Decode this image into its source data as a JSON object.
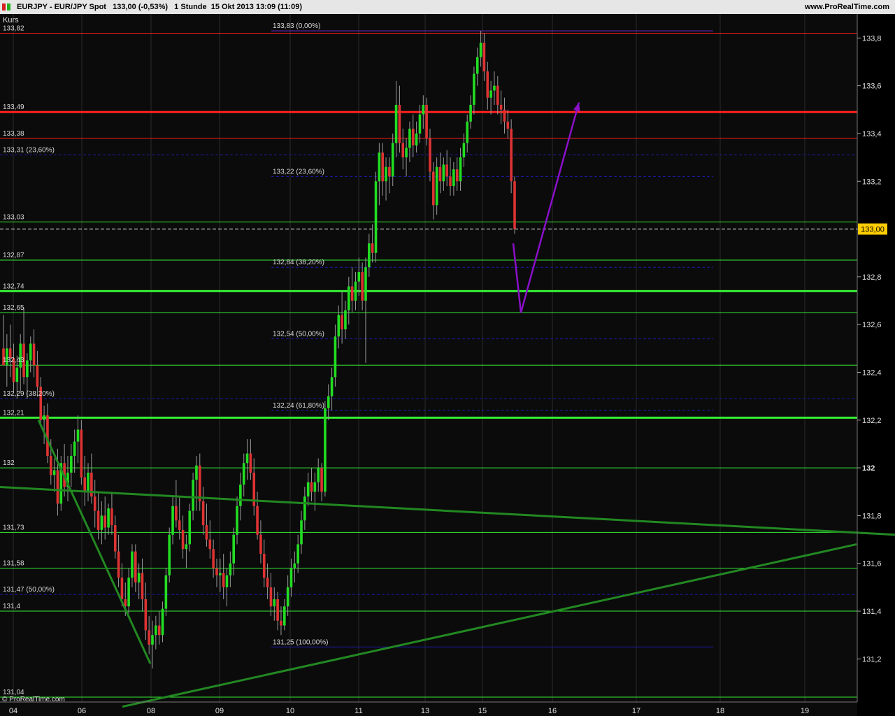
{
  "header": {
    "title": "EURJPY - EUR/JPY Spot   133,00 (-0,53%)   1 Stunde  15 Okt 2013 13:09 (11:09)",
    "website": "www.ProRealTime.com"
  },
  "panel_label": "Kurs",
  "watermark": "© ProRealTime.com",
  "colors": {
    "background": "#0b0b0b",
    "up_candle": "#22dd22",
    "down_candle": "#dd3333",
    "resistance": "#ff2020",
    "support": "#35ee35",
    "fibonacci": "#1a1aa8",
    "trend": "#228822",
    "projection": "#8a10c8",
    "price_tag": "#ffcc00"
  },
  "chart_data": {
    "type": "candlestick",
    "symbol": "EURJPY",
    "interval": "1 Stunde",
    "ylim": [
      131.04,
      133.88
    ],
    "y_ticks": [
      "133,8",
      "133,6",
      "133,4",
      "133,2",
      "133",
      "132,8",
      "132,6",
      "132,4",
      "132,2",
      "132",
      "131,8",
      "131,6",
      "131,4",
      "131,2"
    ],
    "y_tick_values": [
      133.8,
      133.6,
      133.4,
      133.2,
      133.0,
      132.8,
      132.6,
      132.4,
      132.2,
      132.0,
      131.8,
      131.6,
      131.4,
      131.2
    ],
    "x_ticks": [
      "04",
      "06",
      "08",
      "09",
      "10",
      "11",
      "13",
      "15",
      "16",
      "17",
      "18",
      "19"
    ],
    "last_price": "133,00",
    "last_price_value": 133.0,
    "resistance_lines": [
      {
        "label": "133,82",
        "value": 133.82,
        "style": "thin"
      },
      {
        "label": "133,49",
        "value": 133.49,
        "style": "thick"
      },
      {
        "label": "133,38",
        "value": 133.38,
        "style": "thin"
      }
    ],
    "support_lines": [
      {
        "label": "133,03",
        "value": 133.03,
        "style": "thin"
      },
      {
        "label": "132,87",
        "value": 132.87,
        "style": "thin"
      },
      {
        "label": "132,74",
        "value": 132.74,
        "style": "thick"
      },
      {
        "label": "132,65",
        "value": 132.65,
        "style": "thin"
      },
      {
        "label": "132,43",
        "value": 132.43,
        "style": "thin"
      },
      {
        "label": "132,21",
        "value": 132.21,
        "style": "thick"
      },
      {
        "label": "132",
        "value": 132.0,
        "style": "thin"
      },
      {
        "label": "131,73",
        "value": 131.73,
        "style": "thin"
      },
      {
        "label": "131,58",
        "value": 131.58,
        "style": "thin"
      },
      {
        "label": "131,4",
        "value": 131.4,
        "style": "thin"
      },
      {
        "label": "131,04",
        "value": 131.04,
        "style": "thin"
      }
    ],
    "fib_left": [
      {
        "label": "133,31 (23,60%)",
        "value": 133.31
      },
      {
        "label": "132,29 (38,20%)",
        "value": 132.29
      },
      {
        "label": "131,47 (50,00%)",
        "value": 131.47
      }
    ],
    "fib_middle": [
      {
        "label": "133,83 (0,00%)",
        "value": 133.83
      },
      {
        "label": "133,22 (23,60%)",
        "value": 133.22
      },
      {
        "label": "132,84 (38,20%)",
        "value": 132.84
      },
      {
        "label": "132,54 (50,00%)",
        "value": 132.54
      },
      {
        "label": "132,24 (61,80%)",
        "value": 132.24
      },
      {
        "label": "131,25 (100,00%)",
        "value": 131.25
      }
    ],
    "trend_lines": [
      {
        "from": [
          0,
          131.92
        ],
        "to": [
          1280,
          131.72
        ]
      },
      {
        "from": [
          175,
          131.0
        ],
        "to": [
          1225,
          131.68
        ]
      },
      {
        "from": [
          55,
          132.2
        ],
        "to": [
          215,
          131.18
        ]
      }
    ],
    "projection": [
      [
        734,
        132.94
      ],
      [
        745,
        132.65
      ],
      [
        828,
        133.53
      ]
    ],
    "candles": [
      {
        "o": 132.5,
        "h": 132.64,
        "l": 132.43,
        "c": 132.43
      },
      {
        "o": 132.43,
        "h": 132.56,
        "l": 132.34,
        "c": 132.5
      },
      {
        "o": 132.5,
        "h": 132.6,
        "l": 132.38,
        "c": 132.46
      },
      {
        "o": 132.46,
        "h": 132.52,
        "l": 132.32,
        "c": 132.36
      },
      {
        "o": 132.36,
        "h": 132.47,
        "l": 132.29,
        "c": 132.42
      },
      {
        "o": 132.42,
        "h": 132.56,
        "l": 132.32,
        "c": 132.52
      },
      {
        "o": 132.52,
        "h": 132.67,
        "l": 132.35,
        "c": 132.38
      },
      {
        "o": 132.38,
        "h": 132.48,
        "l": 132.29,
        "c": 132.45
      },
      {
        "o": 132.45,
        "h": 132.55,
        "l": 132.4,
        "c": 132.52
      },
      {
        "o": 132.52,
        "h": 132.58,
        "l": 132.38,
        "c": 132.43
      },
      {
        "o": 132.43,
        "h": 132.49,
        "l": 132.3,
        "c": 132.34
      },
      {
        "o": 132.34,
        "h": 132.38,
        "l": 132.17,
        "c": 132.2
      },
      {
        "o": 132.2,
        "h": 132.26,
        "l": 132.1,
        "c": 132.22
      },
      {
        "o": 132.22,
        "h": 132.27,
        "l": 132.02,
        "c": 132.05
      },
      {
        "o": 132.05,
        "h": 132.12,
        "l": 131.93,
        "c": 131.97
      },
      {
        "o": 131.97,
        "h": 132.04,
        "l": 131.9,
        "c": 131.99
      },
      {
        "o": 131.99,
        "h": 132.08,
        "l": 131.8,
        "c": 131.85
      },
      {
        "o": 131.85,
        "h": 132.05,
        "l": 131.82,
        "c": 132.02
      },
      {
        "o": 132.02,
        "h": 132.1,
        "l": 131.88,
        "c": 131.92
      },
      {
        "o": 131.92,
        "h": 132.05,
        "l": 131.86,
        "c": 131.98
      },
      {
        "o": 131.98,
        "h": 132.1,
        "l": 131.92,
        "c": 132.05
      },
      {
        "o": 132.05,
        "h": 132.16,
        "l": 131.98,
        "c": 132.11
      },
      {
        "o": 132.11,
        "h": 132.22,
        "l": 132.02,
        "c": 132.16
      },
      {
        "o": 132.16,
        "h": 132.2,
        "l": 131.93,
        "c": 131.96
      },
      {
        "o": 131.96,
        "h": 132.05,
        "l": 131.84,
        "c": 131.9
      },
      {
        "o": 131.9,
        "h": 132.02,
        "l": 131.86,
        "c": 131.98
      },
      {
        "o": 131.98,
        "h": 132.06,
        "l": 131.85,
        "c": 131.88
      },
      {
        "o": 131.88,
        "h": 131.95,
        "l": 131.75,
        "c": 131.82
      },
      {
        "o": 131.82,
        "h": 131.9,
        "l": 131.7,
        "c": 131.74
      },
      {
        "o": 131.74,
        "h": 131.86,
        "l": 131.68,
        "c": 131.8
      },
      {
        "o": 131.8,
        "h": 131.88,
        "l": 131.7,
        "c": 131.75
      },
      {
        "o": 131.75,
        "h": 131.85,
        "l": 131.72,
        "c": 131.83
      },
      {
        "o": 131.83,
        "h": 131.9,
        "l": 131.72,
        "c": 131.76
      },
      {
        "o": 131.76,
        "h": 131.8,
        "l": 131.62,
        "c": 131.65
      },
      {
        "o": 131.65,
        "h": 131.72,
        "l": 131.5,
        "c": 131.54
      },
      {
        "o": 131.54,
        "h": 131.6,
        "l": 131.42,
        "c": 131.45
      },
      {
        "o": 131.45,
        "h": 131.52,
        "l": 131.38,
        "c": 131.42
      },
      {
        "o": 131.42,
        "h": 131.58,
        "l": 131.39,
        "c": 131.54
      },
      {
        "o": 131.54,
        "h": 131.68,
        "l": 131.5,
        "c": 131.65
      },
      {
        "o": 131.65,
        "h": 131.68,
        "l": 131.48,
        "c": 131.52
      },
      {
        "o": 131.52,
        "h": 131.6,
        "l": 131.45,
        "c": 131.56
      },
      {
        "o": 131.56,
        "h": 131.62,
        "l": 131.4,
        "c": 131.45
      },
      {
        "o": 131.45,
        "h": 131.52,
        "l": 131.28,
        "c": 131.32
      },
      {
        "o": 131.32,
        "h": 131.38,
        "l": 131.22,
        "c": 131.26
      },
      {
        "o": 131.26,
        "h": 131.36,
        "l": 131.16,
        "c": 131.3
      },
      {
        "o": 131.3,
        "h": 131.38,
        "l": 131.24,
        "c": 131.34
      },
      {
        "o": 131.34,
        "h": 131.4,
        "l": 131.26,
        "c": 131.3
      },
      {
        "o": 131.3,
        "h": 131.44,
        "l": 131.27,
        "c": 131.41
      },
      {
        "o": 131.41,
        "h": 131.58,
        "l": 131.38,
        "c": 131.55
      },
      {
        "o": 131.55,
        "h": 131.75,
        "l": 131.52,
        "c": 131.72
      },
      {
        "o": 131.72,
        "h": 131.88,
        "l": 131.68,
        "c": 131.84
      },
      {
        "o": 131.84,
        "h": 131.95,
        "l": 131.75,
        "c": 131.78
      },
      {
        "o": 131.78,
        "h": 131.88,
        "l": 131.7,
        "c": 131.74
      },
      {
        "o": 131.74,
        "h": 131.8,
        "l": 131.62,
        "c": 131.66
      },
      {
        "o": 131.66,
        "h": 131.72,
        "l": 131.58,
        "c": 131.68
      },
      {
        "o": 131.68,
        "h": 131.85,
        "l": 131.65,
        "c": 131.82
      },
      {
        "o": 131.82,
        "h": 131.98,
        "l": 131.78,
        "c": 131.95
      },
      {
        "o": 131.95,
        "h": 132.05,
        "l": 131.82,
        "c": 132.01
      },
      {
        "o": 132.01,
        "h": 132.06,
        "l": 131.82,
        "c": 131.86
      },
      {
        "o": 131.86,
        "h": 131.92,
        "l": 131.72,
        "c": 131.76
      },
      {
        "o": 131.76,
        "h": 131.85,
        "l": 131.67,
        "c": 131.7
      },
      {
        "o": 131.7,
        "h": 131.78,
        "l": 131.62,
        "c": 131.66
      },
      {
        "o": 131.66,
        "h": 131.7,
        "l": 131.54,
        "c": 131.58
      },
      {
        "o": 131.58,
        "h": 131.62,
        "l": 131.5,
        "c": 131.55
      },
      {
        "o": 131.55,
        "h": 131.62,
        "l": 131.48,
        "c": 131.56
      },
      {
        "o": 131.56,
        "h": 131.64,
        "l": 131.45,
        "c": 131.5
      },
      {
        "o": 131.5,
        "h": 131.58,
        "l": 131.42,
        "c": 131.55
      },
      {
        "o": 131.55,
        "h": 131.65,
        "l": 131.5,
        "c": 131.6
      },
      {
        "o": 131.6,
        "h": 131.75,
        "l": 131.55,
        "c": 131.72
      },
      {
        "o": 131.72,
        "h": 131.88,
        "l": 131.68,
        "c": 131.84
      },
      {
        "o": 131.84,
        "h": 131.98,
        "l": 131.78,
        "c": 131.93
      },
      {
        "o": 131.93,
        "h": 132.06,
        "l": 131.88,
        "c": 132.02
      },
      {
        "o": 132.02,
        "h": 132.12,
        "l": 131.95,
        "c": 132.06
      },
      {
        "o": 132.06,
        "h": 132.12,
        "l": 131.95,
        "c": 131.98
      },
      {
        "o": 131.98,
        "h": 132.04,
        "l": 131.8,
        "c": 131.84
      },
      {
        "o": 131.84,
        "h": 131.9,
        "l": 131.7,
        "c": 131.72
      },
      {
        "o": 131.72,
        "h": 131.78,
        "l": 131.6,
        "c": 131.64
      },
      {
        "o": 131.64,
        "h": 131.7,
        "l": 131.5,
        "c": 131.54
      },
      {
        "o": 131.54,
        "h": 131.6,
        "l": 131.45,
        "c": 131.5
      },
      {
        "o": 131.5,
        "h": 131.56,
        "l": 131.38,
        "c": 131.42
      },
      {
        "o": 131.42,
        "h": 131.5,
        "l": 131.36,
        "c": 131.45
      },
      {
        "o": 131.45,
        "h": 131.48,
        "l": 131.32,
        "c": 131.36
      },
      {
        "o": 131.36,
        "h": 131.42,
        "l": 131.3,
        "c": 131.34
      },
      {
        "o": 131.34,
        "h": 131.45,
        "l": 131.32,
        "c": 131.42
      },
      {
        "o": 131.42,
        "h": 131.55,
        "l": 131.38,
        "c": 131.5
      },
      {
        "o": 131.5,
        "h": 131.62,
        "l": 131.46,
        "c": 131.58
      },
      {
        "o": 131.58,
        "h": 131.65,
        "l": 131.52,
        "c": 131.6
      },
      {
        "o": 131.6,
        "h": 131.72,
        "l": 131.56,
        "c": 131.68
      },
      {
        "o": 131.68,
        "h": 131.82,
        "l": 131.64,
        "c": 131.78
      },
      {
        "o": 131.78,
        "h": 131.92,
        "l": 131.74,
        "c": 131.88
      },
      {
        "o": 131.88,
        "h": 131.98,
        "l": 131.84,
        "c": 131.94
      },
      {
        "o": 131.94,
        "h": 132.0,
        "l": 131.86,
        "c": 131.9
      },
      {
        "o": 131.9,
        "h": 131.98,
        "l": 131.82,
        "c": 131.94
      },
      {
        "o": 131.94,
        "h": 132.04,
        "l": 131.9,
        "c": 132.0
      },
      {
        "o": 132.0,
        "h": 132.02,
        "l": 131.86,
        "c": 131.9
      },
      {
        "o": 131.9,
        "h": 132.28,
        "l": 131.88,
        "c": 132.25
      },
      {
        "o": 132.25,
        "h": 132.35,
        "l": 132.2,
        "c": 132.3
      },
      {
        "o": 132.3,
        "h": 132.42,
        "l": 132.24,
        "c": 132.38
      },
      {
        "o": 132.38,
        "h": 132.6,
        "l": 132.34,
        "c": 132.55
      },
      {
        "o": 132.55,
        "h": 132.68,
        "l": 132.5,
        "c": 132.64
      },
      {
        "o": 132.64,
        "h": 132.74,
        "l": 132.52,
        "c": 132.58
      },
      {
        "o": 132.58,
        "h": 132.7,
        "l": 132.54,
        "c": 132.66
      },
      {
        "o": 132.66,
        "h": 132.8,
        "l": 132.6,
        "c": 132.76
      },
      {
        "o": 132.76,
        "h": 132.84,
        "l": 132.65,
        "c": 132.7
      },
      {
        "o": 132.7,
        "h": 132.82,
        "l": 132.66,
        "c": 132.78
      },
      {
        "o": 132.78,
        "h": 132.88,
        "l": 132.72,
        "c": 132.82
      },
      {
        "o": 132.82,
        "h": 132.86,
        "l": 132.66,
        "c": 132.7
      },
      {
        "o": 132.7,
        "h": 132.88,
        "l": 132.44,
        "c": 132.84
      },
      {
        "o": 132.84,
        "h": 132.98,
        "l": 132.8,
        "c": 132.94
      },
      {
        "o": 132.94,
        "h": 133.02,
        "l": 132.86,
        "c": 132.9
      },
      {
        "o": 132.9,
        "h": 133.24,
        "l": 132.86,
        "c": 133.2
      },
      {
        "o": 133.2,
        "h": 133.36,
        "l": 133.1,
        "c": 133.32
      },
      {
        "o": 133.32,
        "h": 133.36,
        "l": 133.14,
        "c": 133.2
      },
      {
        "o": 133.2,
        "h": 133.3,
        "l": 133.12,
        "c": 133.26
      },
      {
        "o": 133.26,
        "h": 133.3,
        "l": 133.15,
        "c": 133.22
      },
      {
        "o": 133.22,
        "h": 133.4,
        "l": 133.18,
        "c": 133.36
      },
      {
        "o": 133.36,
        "h": 133.62,
        "l": 133.3,
        "c": 133.52
      },
      {
        "o": 133.52,
        "h": 133.6,
        "l": 133.32,
        "c": 133.36
      },
      {
        "o": 133.36,
        "h": 133.42,
        "l": 133.25,
        "c": 133.3
      },
      {
        "o": 133.3,
        "h": 133.38,
        "l": 133.22,
        "c": 133.34
      },
      {
        "o": 133.34,
        "h": 133.45,
        "l": 133.28,
        "c": 133.42
      },
      {
        "o": 133.42,
        "h": 133.48,
        "l": 133.3,
        "c": 133.35
      },
      {
        "o": 133.35,
        "h": 133.45,
        "l": 133.32,
        "c": 133.4
      },
      {
        "o": 133.4,
        "h": 133.52,
        "l": 133.36,
        "c": 133.48
      },
      {
        "o": 133.48,
        "h": 133.56,
        "l": 133.42,
        "c": 133.52
      },
      {
        "o": 133.52,
        "h": 133.55,
        "l": 133.35,
        "c": 133.38
      },
      {
        "o": 133.38,
        "h": 133.42,
        "l": 133.2,
        "c": 133.24
      },
      {
        "o": 133.24,
        "h": 133.28,
        "l": 133.04,
        "c": 133.1
      },
      {
        "o": 133.1,
        "h": 133.3,
        "l": 133.06,
        "c": 133.26
      },
      {
        "o": 133.26,
        "h": 133.32,
        "l": 133.15,
        "c": 133.2
      },
      {
        "o": 133.2,
        "h": 133.3,
        "l": 133.16,
        "c": 133.27
      },
      {
        "o": 133.27,
        "h": 133.33,
        "l": 133.18,
        "c": 133.22
      },
      {
        "o": 133.22,
        "h": 133.3,
        "l": 133.14,
        "c": 133.18
      },
      {
        "o": 133.18,
        "h": 133.28,
        "l": 133.14,
        "c": 133.25
      },
      {
        "o": 133.25,
        "h": 133.3,
        "l": 133.16,
        "c": 133.2
      },
      {
        "o": 133.2,
        "h": 133.34,
        "l": 133.16,
        "c": 133.3
      },
      {
        "o": 133.3,
        "h": 133.4,
        "l": 133.26,
        "c": 133.36
      },
      {
        "o": 133.36,
        "h": 133.48,
        "l": 133.32,
        "c": 133.45
      },
      {
        "o": 133.45,
        "h": 133.56,
        "l": 133.42,
        "c": 133.52
      },
      {
        "o": 133.52,
        "h": 133.68,
        "l": 133.48,
        "c": 133.65
      },
      {
        "o": 133.65,
        "h": 133.76,
        "l": 133.6,
        "c": 133.72
      },
      {
        "o": 133.72,
        "h": 133.83,
        "l": 133.68,
        "c": 133.78
      },
      {
        "o": 133.78,
        "h": 133.82,
        "l": 133.62,
        "c": 133.66
      },
      {
        "o": 133.66,
        "h": 133.7,
        "l": 133.5,
        "c": 133.55
      },
      {
        "o": 133.55,
        "h": 133.62,
        "l": 133.48,
        "c": 133.58
      },
      {
        "o": 133.58,
        "h": 133.66,
        "l": 133.52,
        "c": 133.6
      },
      {
        "o": 133.6,
        "h": 133.64,
        "l": 133.48,
        "c": 133.52
      },
      {
        "o": 133.52,
        "h": 133.58,
        "l": 133.44,
        "c": 133.5
      },
      {
        "o": 133.5,
        "h": 133.55,
        "l": 133.4,
        "c": 133.45
      },
      {
        "o": 133.45,
        "h": 133.5,
        "l": 133.38,
        "c": 133.42
      },
      {
        "o": 133.42,
        "h": 133.46,
        "l": 133.15,
        "c": 133.2
      },
      {
        "o": 133.2,
        "h": 133.22,
        "l": 132.98,
        "c": 133.0
      }
    ]
  }
}
